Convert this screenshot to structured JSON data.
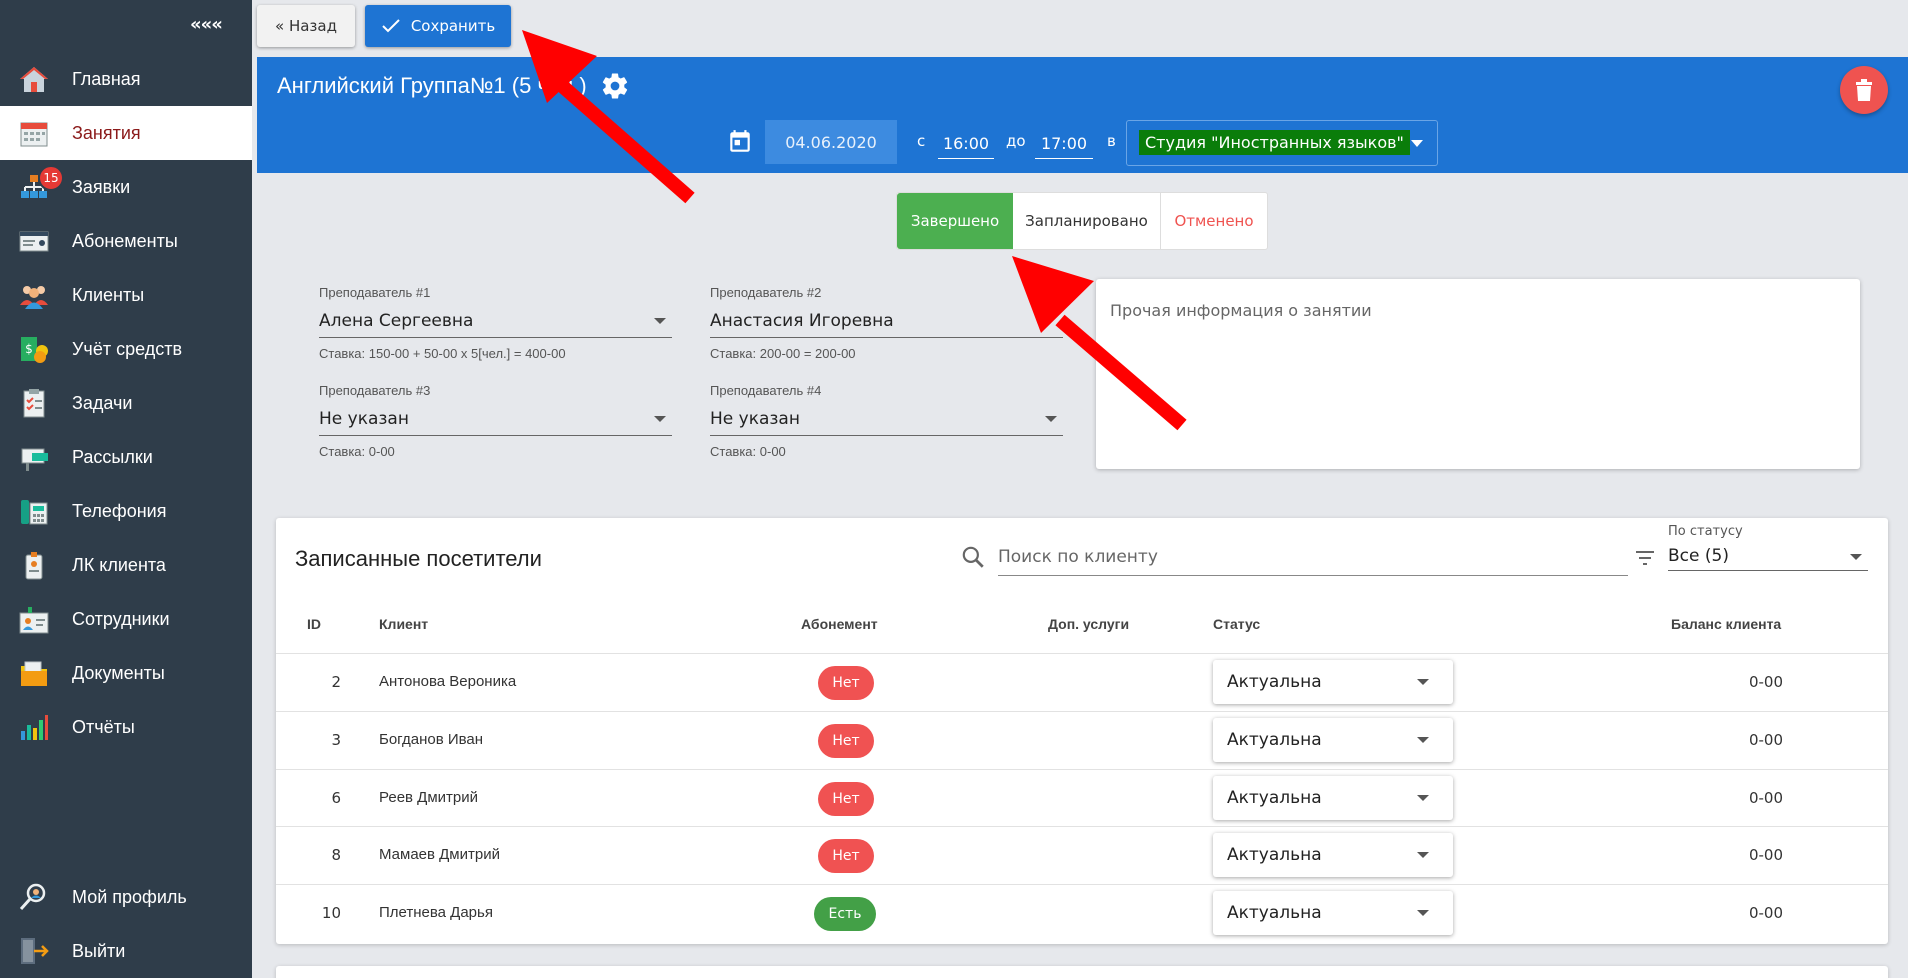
{
  "sidebar": {
    "collapse_label": "«««",
    "items": [
      {
        "label": "Главная",
        "icon": "home-icon"
      },
      {
        "label": "Занятия",
        "icon": "calendar-icon",
        "active": true
      },
      {
        "label": "Заявки",
        "icon": "requests-icon",
        "badge": "15"
      },
      {
        "label": "Абонементы",
        "icon": "subscription-card-icon"
      },
      {
        "label": "Клиенты",
        "icon": "clients-icon"
      },
      {
        "label": "Учёт средств",
        "icon": "money-icon"
      },
      {
        "label": "Задачи",
        "icon": "tasks-icon"
      },
      {
        "label": "Рассылки",
        "icon": "mailing-icon"
      },
      {
        "label": "Телефония",
        "icon": "phone-icon"
      },
      {
        "label": "ЛК клиента",
        "icon": "client-account-icon"
      },
      {
        "label": "Сотрудники",
        "icon": "staff-icon"
      },
      {
        "label": "Документы",
        "icon": "documents-icon"
      },
      {
        "label": "Отчёты",
        "icon": "reports-icon"
      }
    ],
    "bottom_items": [
      {
        "label": "Мой профиль",
        "icon": "profile-icon"
      },
      {
        "label": "Выйти",
        "icon": "logout-icon"
      }
    ]
  },
  "toolbar": {
    "back_label": "« Назад",
    "save_label": "Сохранить"
  },
  "lesson": {
    "title": "Английский Группа№1 (5 чел.)",
    "date": "04.06.2020",
    "from_label": "с",
    "time_from": "16:00",
    "to_label": "до",
    "time_to": "17:00",
    "in_label": "в",
    "room": "Студия \"Иностранных языков\""
  },
  "status_buttons": {
    "done": "Завершено",
    "planned": "Запланировано",
    "cancelled": "Отменено"
  },
  "teachers": [
    {
      "label": "Преподаватель #1",
      "value": "Алена Сергеевна",
      "rate": "Ставка: 150-00 + 50-00 x 5[чел.] = 400-00"
    },
    {
      "label": "Преподаватель #2",
      "value": "Анастасия Игоревна",
      "rate": "Ставка: 200-00 = 200-00"
    },
    {
      "label": "Преподаватель #3",
      "value": "Не указан",
      "rate": "Ставка: 0-00"
    },
    {
      "label": "Преподаватель #4",
      "value": "Не указан",
      "rate": "Ставка: 0-00"
    }
  ],
  "notes": {
    "placeholder": "Прочая информация о занятии"
  },
  "visitors": {
    "title": "Записанные посетители",
    "search_placeholder": "Поиск по клиенту",
    "status_filter_label": "По статусу",
    "status_filter_value": "Все (5)",
    "columns": {
      "id": "ID",
      "client": "Клиент",
      "subscription": "Абонемент",
      "extra": "Доп. услуги",
      "status": "Статус",
      "balance": "Баланс клиента"
    },
    "rows": [
      {
        "id": "2",
        "client": "Антонова Вероника",
        "subscription": "Нет",
        "has_sub": false,
        "status": "Актуальна",
        "balance": "0-00"
      },
      {
        "id": "3",
        "client": "Богданов Иван",
        "subscription": "Нет",
        "has_sub": false,
        "status": "Актуальна",
        "balance": "0-00"
      },
      {
        "id": "6",
        "client": "Реев Дмитрий",
        "subscription": "Нет",
        "has_sub": false,
        "status": "Актуальна",
        "balance": "0-00"
      },
      {
        "id": "8",
        "client": "Мамаев Дмитрий",
        "subscription": "Нет",
        "has_sub": false,
        "status": "Актуальна",
        "balance": "0-00"
      },
      {
        "id": "10",
        "client": "Плетнева Дарья",
        "subscription": "Есть",
        "has_sub": true,
        "status": "Актуальна",
        "balance": "0-00"
      }
    ]
  },
  "colors": {
    "sidebar_bg": "#2f3d4a",
    "header_blue": "#1e74d3",
    "done_green": "#4caf50",
    "cancel_red": "#ef5350",
    "badge_red": "#e53935",
    "room_green": "#0a7d0a",
    "annotation_arrow": "#ff0000"
  }
}
